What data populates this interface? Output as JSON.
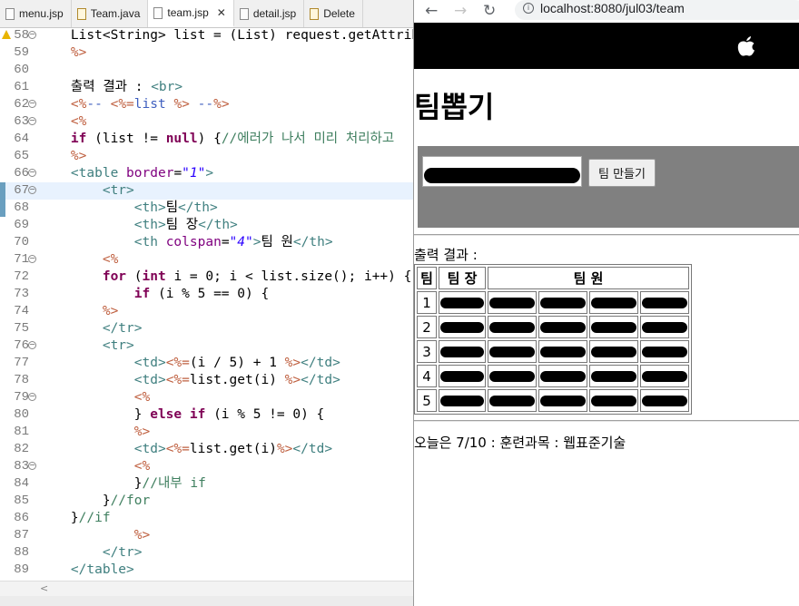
{
  "editor": {
    "tabs": [
      {
        "label": "menu.jsp",
        "active": false,
        "icon": "jsp-file-icon"
      },
      {
        "label": "Team.java",
        "active": false,
        "icon": "java-file-icon"
      },
      {
        "label": "team.jsp",
        "active": true,
        "icon": "jsp-file-icon"
      },
      {
        "label": "detail.jsp",
        "active": false,
        "icon": "jsp-file-icon"
      },
      {
        "label": "Delete",
        "active": false,
        "icon": "java-file-icon"
      }
    ],
    "lines": [
      {
        "n": "58",
        "text": "List<String> list = (List) request.getAttribute"
      },
      {
        "n": "59",
        "text": "%>"
      },
      {
        "n": "60",
        "text": ""
      },
      {
        "n": "61",
        "text": "출력 결과 : <br>"
      },
      {
        "n": "62",
        "text": "<%-- <%=list %> --%>"
      },
      {
        "n": "63",
        "text": "<%"
      },
      {
        "n": "64",
        "text": "if (list != null) {//에러가 나서 미리 처리하고 "
      },
      {
        "n": "65",
        "text": "%>"
      },
      {
        "n": "66",
        "text": "<table border=\"1\">"
      },
      {
        "n": "67",
        "text": "    <tr>"
      },
      {
        "n": "68",
        "text": "        <th>팀</th>"
      },
      {
        "n": "69",
        "text": "        <th>팀 장</th>"
      },
      {
        "n": "70",
        "text": "        <th colspan=\"4\">팀 원</th>"
      },
      {
        "n": "71",
        "text": "    <%"
      },
      {
        "n": "72",
        "text": "    for (int i = 0; i < list.size(); i++) {"
      },
      {
        "n": "73",
        "text": "        if (i % 5 == 0) {"
      },
      {
        "n": "74",
        "text": "    %>"
      },
      {
        "n": "75",
        "text": "    </tr>"
      },
      {
        "n": "76",
        "text": "    <tr>"
      },
      {
        "n": "77",
        "text": "        <td><%=(i / 5) + 1 %></td>"
      },
      {
        "n": "78",
        "text": "        <td><%=list.get(i) %></td>"
      },
      {
        "n": "79",
        "text": "        <%"
      },
      {
        "n": "80",
        "text": "        } else if (i % 5 != 0) {"
      },
      {
        "n": "81",
        "text": "        %>"
      },
      {
        "n": "82",
        "text": "        <td><%=list.get(i)%></td>"
      },
      {
        "n": "83",
        "text": "        <%"
      },
      {
        "n": "84",
        "text": "        }//내부 if"
      },
      {
        "n": "85",
        "text": "    }//for"
      },
      {
        "n": "86",
        "text": "}//if"
      },
      {
        "n": "87",
        "text": "        %>"
      },
      {
        "n": "88",
        "text": "    </tr>"
      },
      {
        "n": "89",
        "text": "</table>"
      }
    ]
  },
  "browser": {
    "url": "localhost:8080/jul03/team",
    "nav": {
      "back": "←",
      "forward": "→",
      "reload": "↻"
    },
    "title": "팀뽑기",
    "input_value": "",
    "button_label": "팀 만들기",
    "output_label": "출력 결과 :",
    "table_headers": [
      "팀",
      "팀 장",
      "팀 원"
    ],
    "team_numbers": [
      "1",
      "2",
      "3",
      "4",
      "5"
    ],
    "footer": "오늘은 7/10 : 훈련과목 : 웹표준기술"
  },
  "colors": {
    "keyword": "#7f0055",
    "tag": "#3f7f7f",
    "jsp": "#bf5f3f",
    "attr": "#7f007f",
    "string": "#2a00ff",
    "comment": "#3f5fbf",
    "java_comment": "#3f7f5f",
    "form_bg": "#808080",
    "header_bar": "#000000"
  }
}
